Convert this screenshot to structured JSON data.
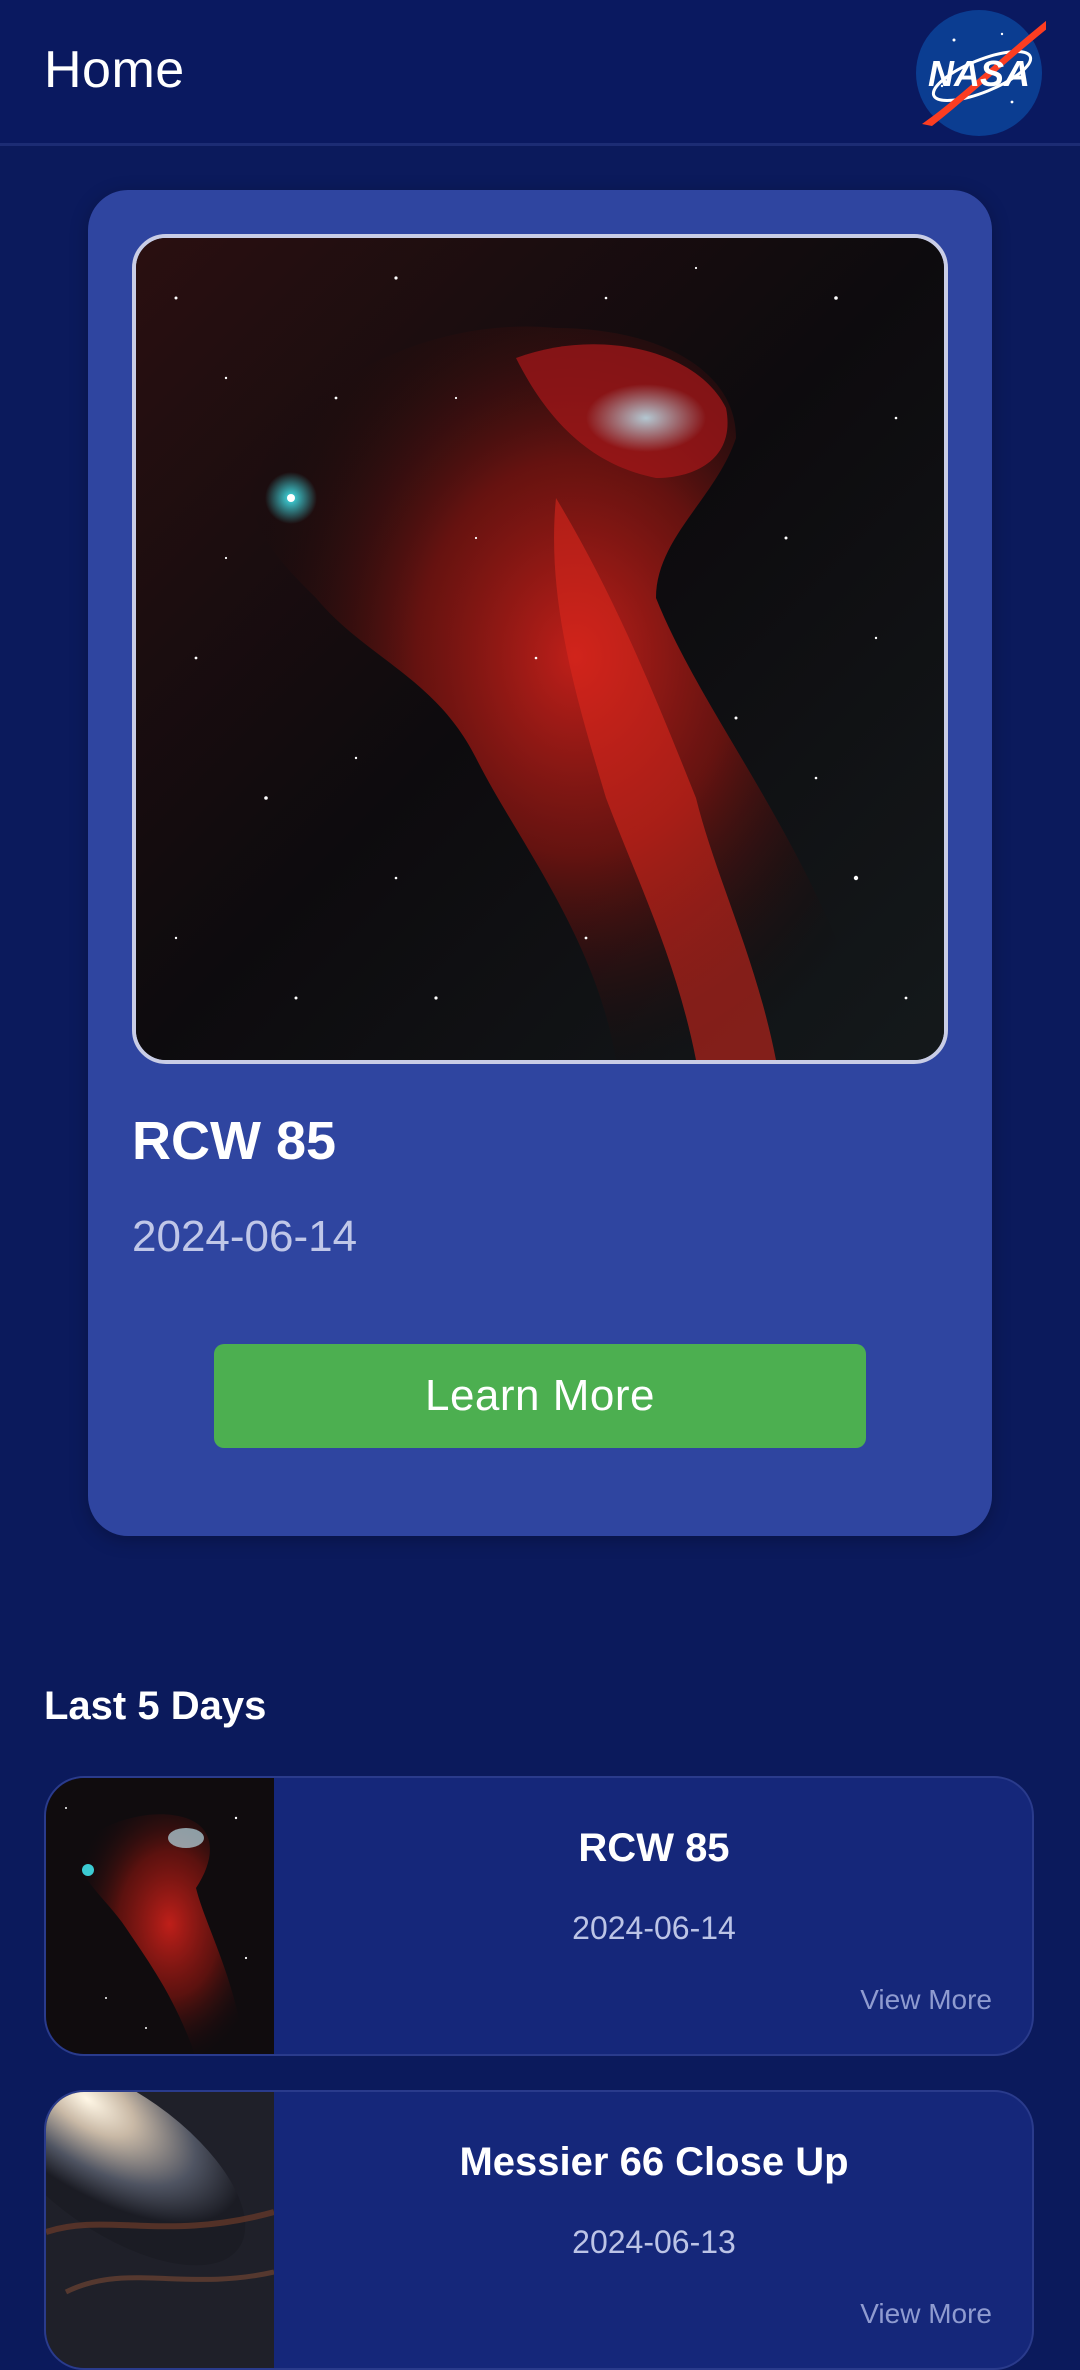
{
  "app_bar": {
    "title": "Home",
    "logo_icon": "nasa-logo-icon",
    "logo_text": "NASA"
  },
  "featured": {
    "title": "RCW 85",
    "date": "2024-06-14",
    "button_label": "Learn More",
    "image": "nebula-image"
  },
  "recent": {
    "title": "Last 5 Days",
    "items": [
      {
        "title": "RCW 85",
        "date": "2024-06-14",
        "view_more": "View More",
        "thumbnail": "nebula-thumbnail"
      },
      {
        "title": "Messier 66 Close Up",
        "date": "2024-06-13",
        "view_more": "View More",
        "thumbnail": "galaxy-thumbnail"
      }
    ]
  },
  "colors": {
    "background": "#0b1a5c",
    "card": "#2f45a0",
    "list_card": "#15277a",
    "button": "#4caf50"
  }
}
